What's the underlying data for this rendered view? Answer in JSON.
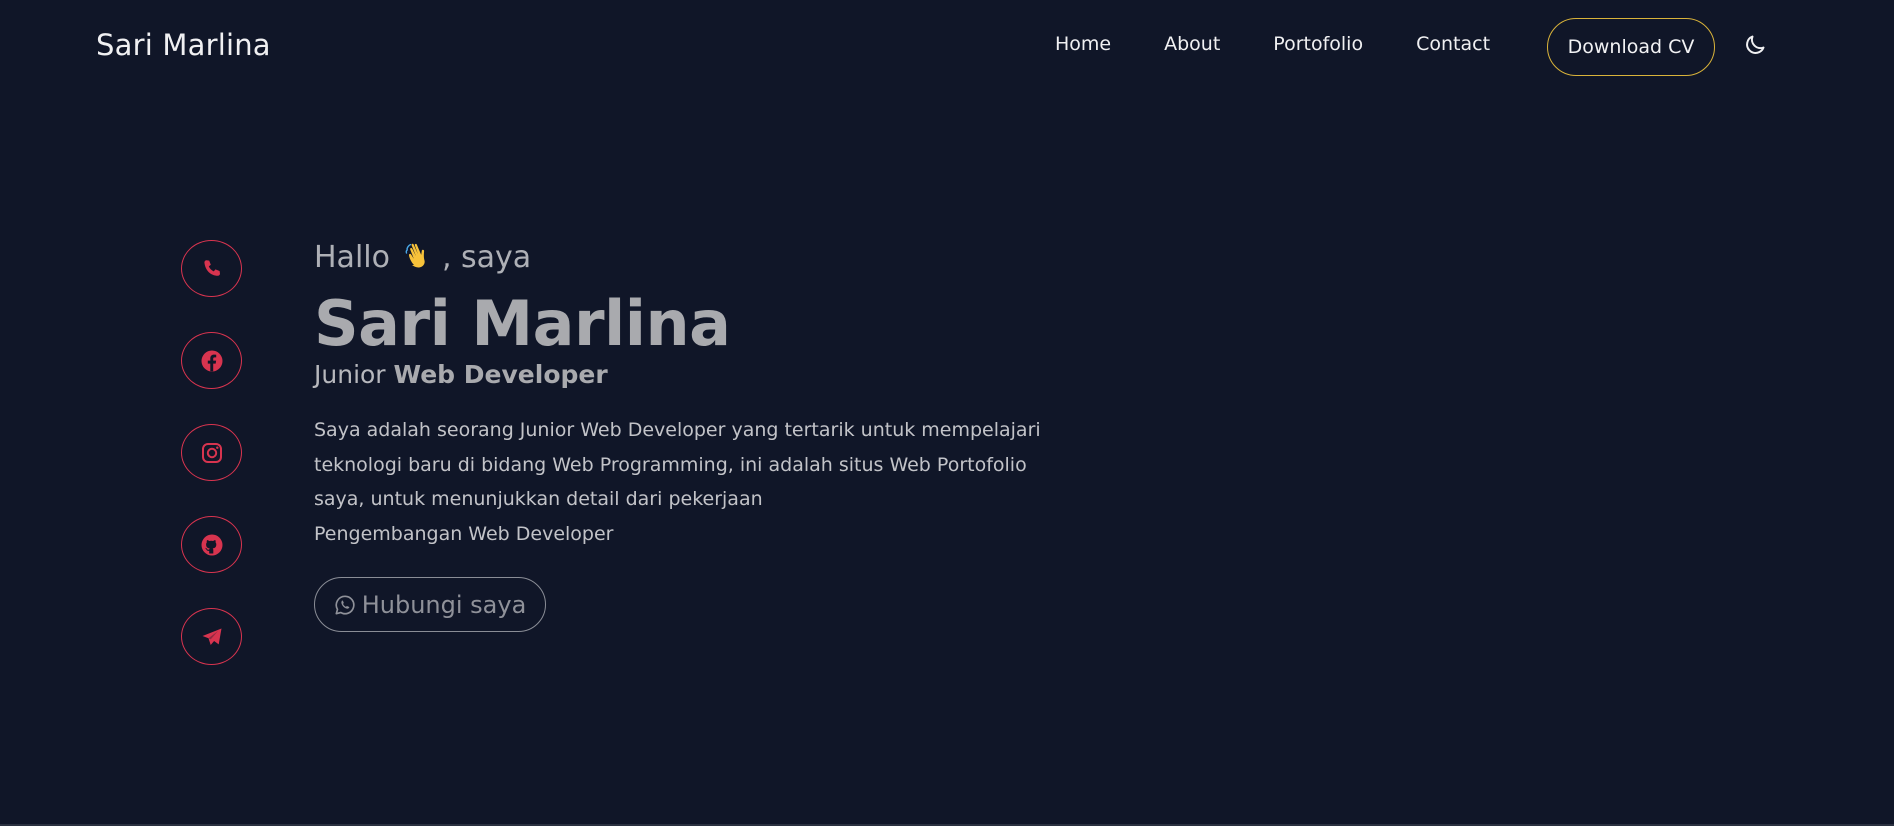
{
  "colors": {
    "background": "#101628",
    "accent_social": "#d8344f",
    "cv_border": "#d9b33a"
  },
  "nav": {
    "brand": "Sari Marlina",
    "menu": [
      {
        "label": "Home"
      },
      {
        "label": "About"
      },
      {
        "label": "Portofolio"
      },
      {
        "label": "Contact"
      }
    ],
    "cv_button": "Download CV",
    "theme_icon": "moon-icon"
  },
  "socials": [
    {
      "icon": "phone-icon"
    },
    {
      "icon": "facebook-icon"
    },
    {
      "icon": "instagram-icon"
    },
    {
      "icon": "github-icon"
    },
    {
      "icon": "telegram-icon"
    }
  ],
  "hero": {
    "greeting_before": "Hallo",
    "greeting_emoji": "waving-hand-icon",
    "greeting_after": ", saya",
    "name": "Sari Marlina",
    "role_prefix": "Junior",
    "role_main": "Web Developer",
    "description_lines": [
      "Saya adalah seorang Junior Web Developer yang tertarik untuk mempelajari",
      "teknologi baru di bidang Web Programming, ini adalah situs Web Portofolio",
      "saya, untuk menunjukkan detail dari pekerjaan",
      "Pengembangan Web Developer"
    ],
    "cta_label": "Hubungi saya",
    "cta_icon": "whatsapp-icon"
  }
}
